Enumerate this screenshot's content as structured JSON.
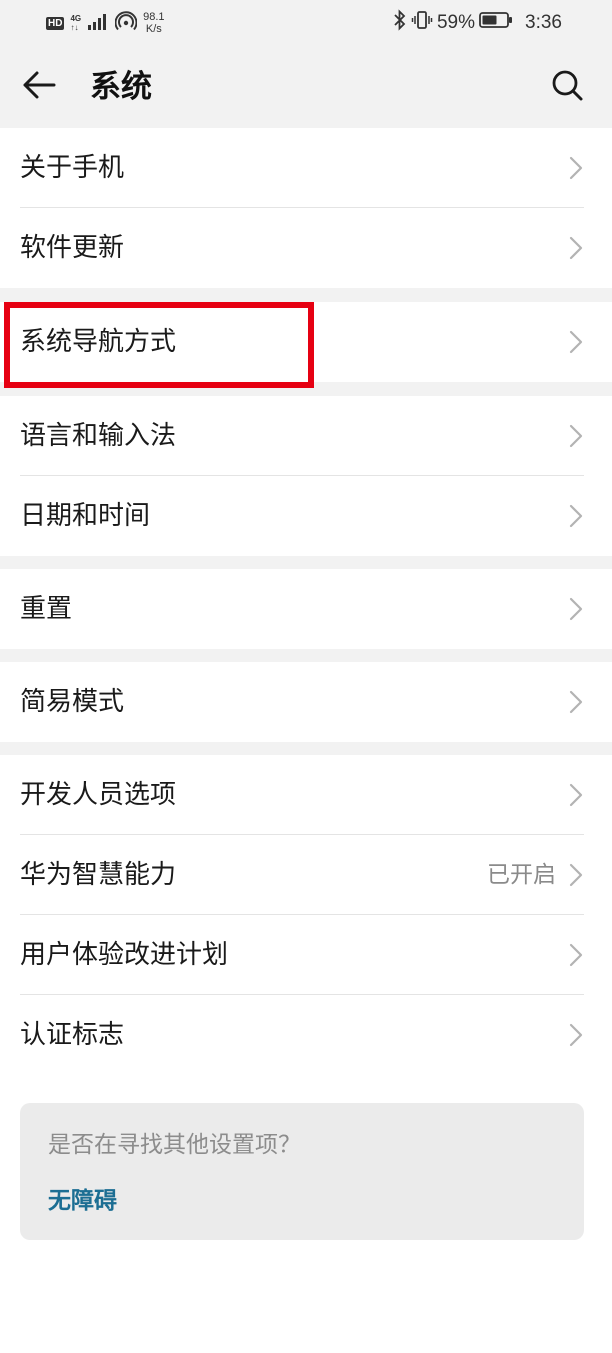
{
  "status_bar": {
    "hd": "HD",
    "network_type": "4G",
    "network_sub": "↑↓",
    "speed_value": "98.1",
    "speed_unit": "K/s",
    "battery_percent": "59%",
    "time": "3:36"
  },
  "header": {
    "title": "系统"
  },
  "groups": [
    {
      "items": [
        {
          "label": "关于手机"
        },
        {
          "label": "软件更新"
        }
      ]
    },
    {
      "items": [
        {
          "label": "系统导航方式"
        }
      ]
    },
    {
      "items": [
        {
          "label": "语言和输入法"
        },
        {
          "label": "日期和时间"
        }
      ]
    },
    {
      "items": [
        {
          "label": "重置"
        }
      ]
    },
    {
      "items": [
        {
          "label": "简易模式"
        }
      ]
    },
    {
      "items": [
        {
          "label": "开发人员选项"
        },
        {
          "label": "华为智慧能力",
          "value": "已开启"
        },
        {
          "label": "用户体验改进计划"
        },
        {
          "label": "认证标志"
        }
      ]
    }
  ],
  "suggestion": {
    "question": "是否在寻找其他设置项？",
    "link": "无障碍"
  },
  "colors": {
    "background": "#f2f2f2",
    "card": "#ffffff",
    "link": "#1c6e93",
    "highlight": "#e60012"
  }
}
